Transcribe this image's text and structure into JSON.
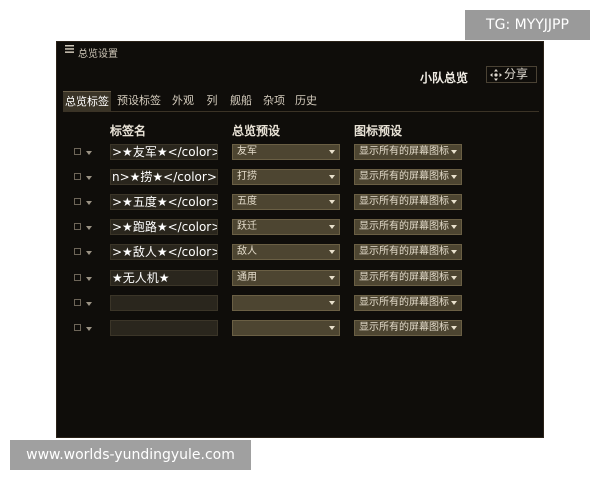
{
  "watermarks": {
    "top": "TG: MYYJJPP",
    "bottom": "www.worlds-yundingyule.com"
  },
  "window": {
    "title": "总览设置",
    "fleet_title": "小队总览",
    "share_label": "分享"
  },
  "tabs": [
    {
      "label": "总览标签",
      "active": true
    },
    {
      "label": "预设标签",
      "active": false
    },
    {
      "label": "外观",
      "active": false
    },
    {
      "label": "列",
      "active": false
    },
    {
      "label": "舰船",
      "active": false
    },
    {
      "label": "杂项",
      "active": false
    },
    {
      "label": "历史",
      "active": false
    }
  ],
  "columns": {
    "name": "标签名",
    "overview_preset": "总览预设",
    "icon_preset": "图标预设"
  },
  "rows": [
    {
      "name": ">★友军★</color>",
      "overview": "友军",
      "icon": "显示所有的屏幕图标"
    },
    {
      "name": "n>★捞★</color>",
      "overview": "打捞",
      "icon": "显示所有的屏幕图标"
    },
    {
      "name": ">★五度★</color>",
      "overview": "五度",
      "icon": "显示所有的屏幕图标"
    },
    {
      "name": ">★跑路★</color>",
      "overview": "跃迁",
      "icon": "显示所有的屏幕图标"
    },
    {
      "name": ">★敌人★</color>",
      "overview": "敌人",
      "icon": "显示所有的屏幕图标"
    },
    {
      "name": " ★无人机★",
      "overview": "通用",
      "icon": "显示所有的屏幕图标"
    },
    {
      "name": "",
      "overview": "",
      "icon": "显示所有的屏幕图标"
    },
    {
      "name": "",
      "overview": "",
      "icon": "显示所有的屏幕图标"
    }
  ],
  "colors": {
    "window_bg": "#0f0d0a",
    "select_bg": "#4d4531",
    "tab_active_bg": "#3a3427",
    "name_field_bg": "#2a261d"
  },
  "icons": {
    "menu": "hamburger-icon",
    "share": "share-icon",
    "dropdown": "chevron-down-icon"
  }
}
